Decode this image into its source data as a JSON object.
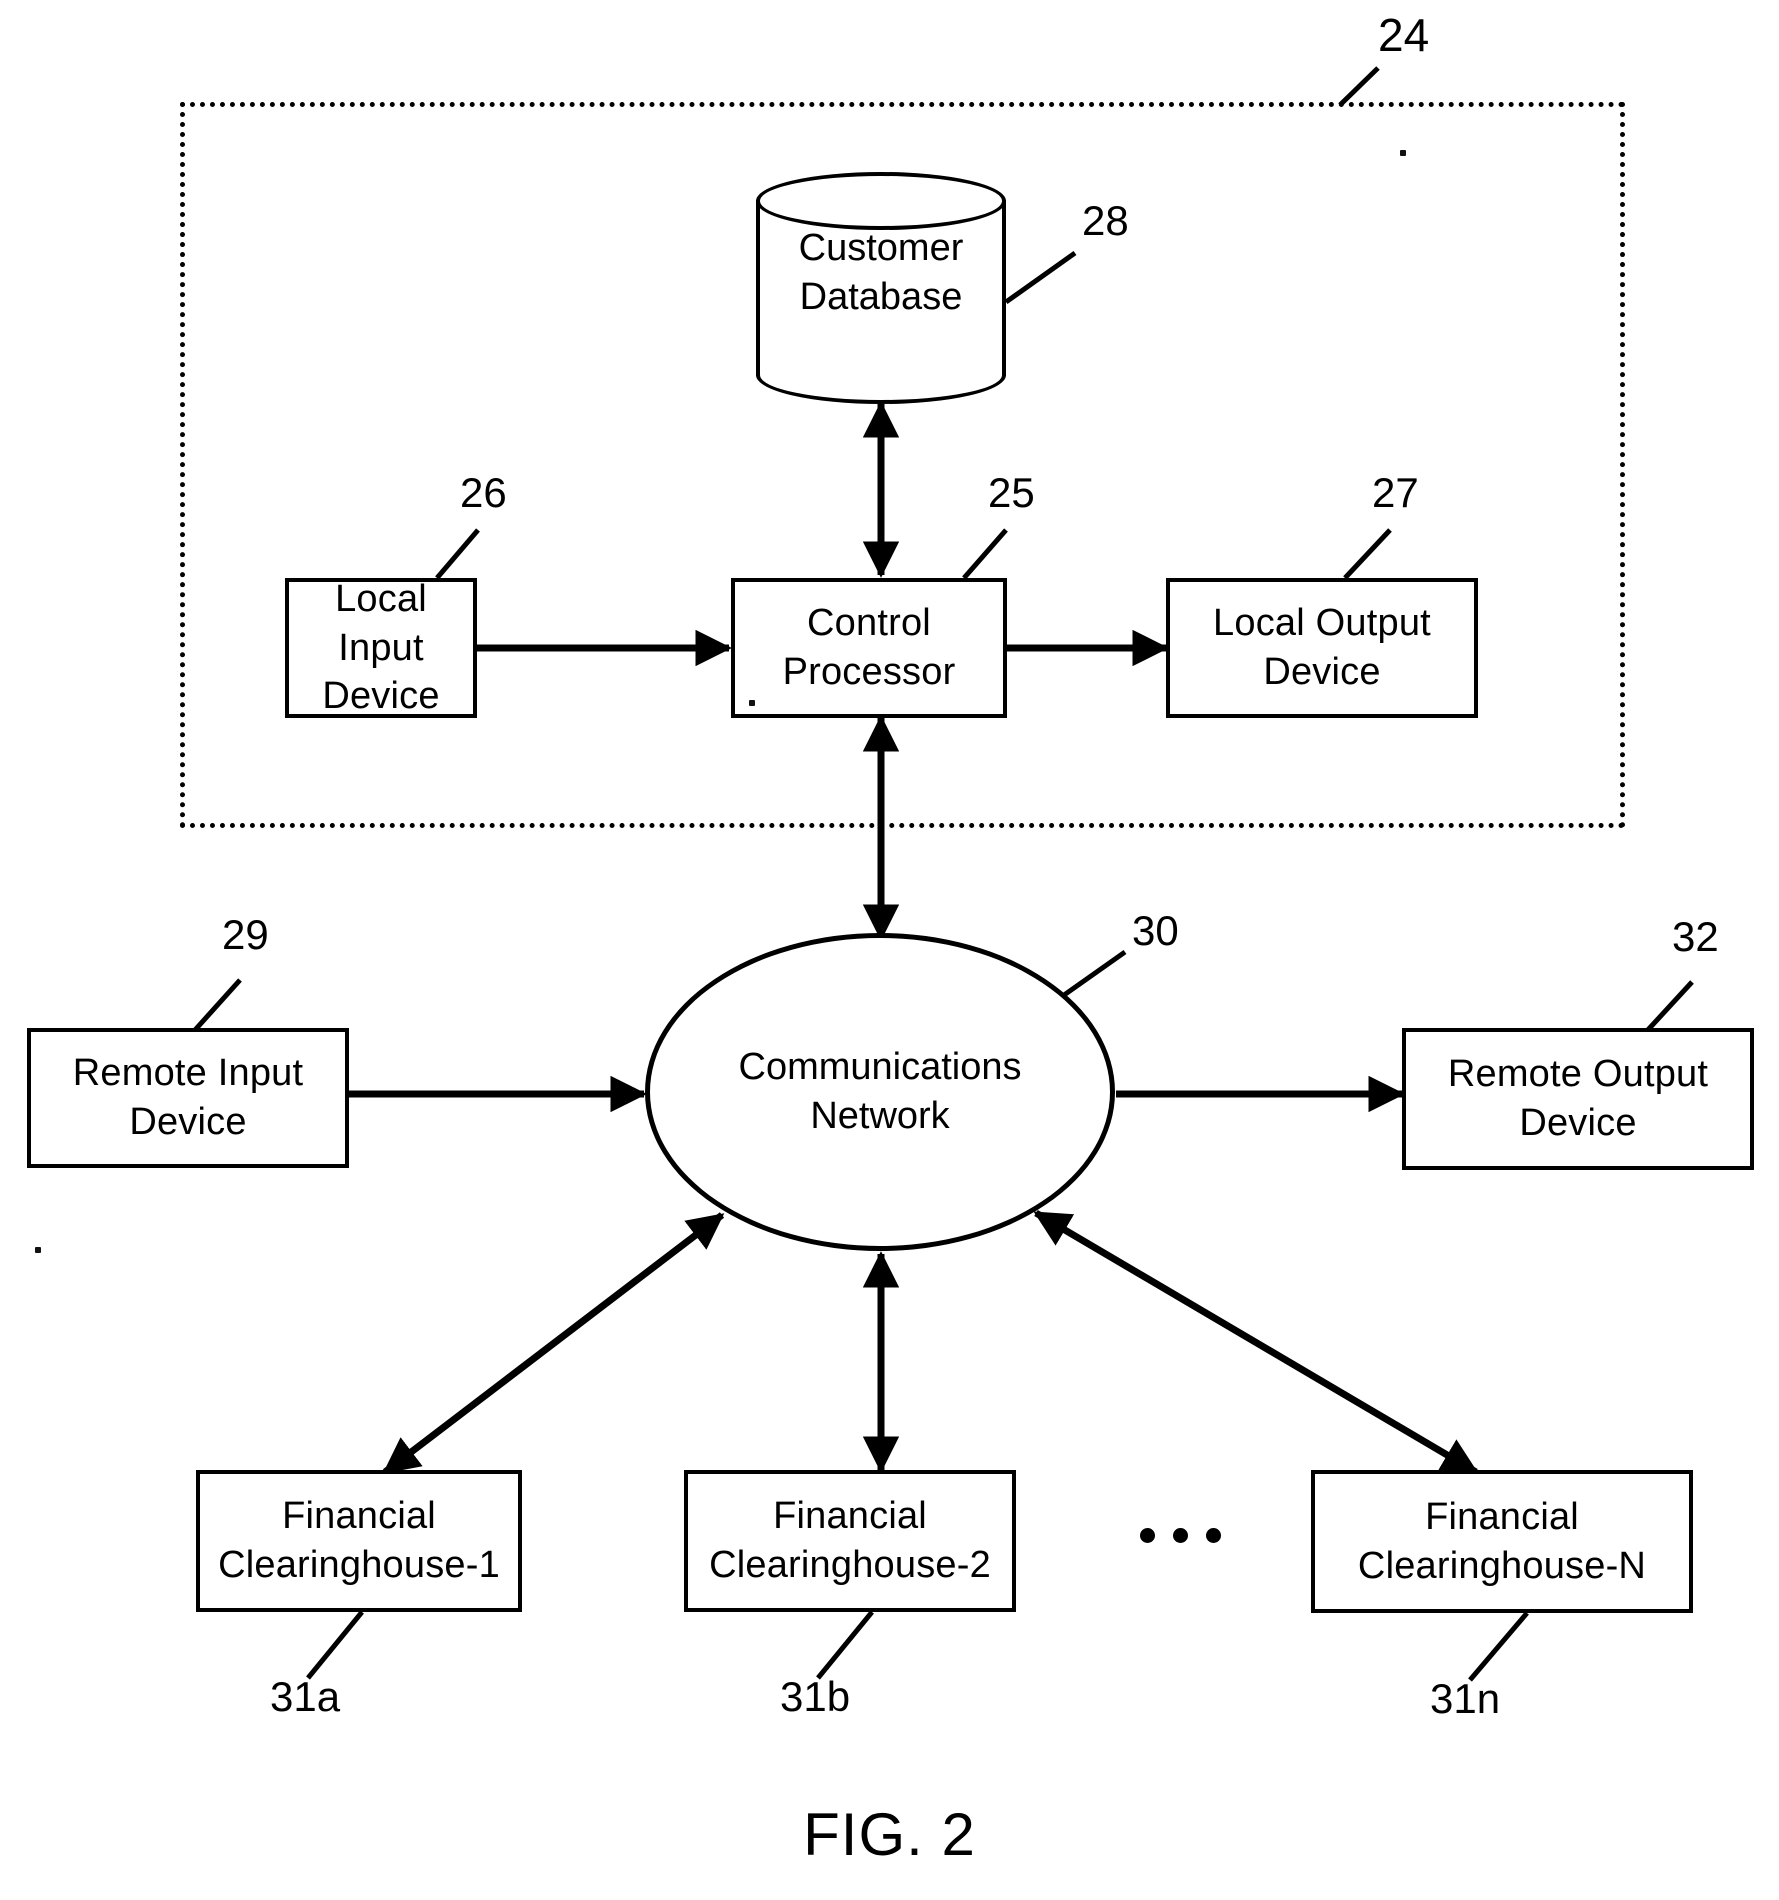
{
  "figure": {
    "caption": "FIG. 2",
    "enclosure": {
      "name": "system enclosure",
      "ref": "24"
    }
  },
  "nodes": [
    {
      "id": "customer-database",
      "label": "Customer\nDatabase",
      "ref": "28",
      "shape": "cylinder"
    },
    {
      "id": "local-input-device",
      "label": "Local Input\nDevice",
      "ref": "26",
      "shape": "rectangle"
    },
    {
      "id": "control-processor",
      "label": "Control\nProcessor",
      "ref": "25",
      "shape": "rectangle"
    },
    {
      "id": "local-output-device",
      "label": "Local Output\nDevice",
      "ref": "27",
      "shape": "rectangle"
    },
    {
      "id": "communications-network",
      "label": "Communications\nNetwork",
      "ref": "30",
      "shape": "ellipse"
    },
    {
      "id": "remote-input-device",
      "label": "Remote Input\nDevice",
      "ref": "29",
      "shape": "rectangle"
    },
    {
      "id": "remote-output-device",
      "label": "Remote Output\nDevice",
      "ref": "32",
      "shape": "rectangle"
    },
    {
      "id": "financial-clearinghouse-1",
      "label": "Financial\nClearinghouse-1",
      "ref": "31a",
      "shape": "rectangle"
    },
    {
      "id": "financial-clearinghouse-2",
      "label": "Financial\nClearinghouse-2",
      "ref": "31b",
      "shape": "rectangle"
    },
    {
      "id": "financial-clearinghouse-n",
      "label": "Financial\nClearinghouse-N",
      "ref": "31n",
      "shape": "rectangle"
    }
  ],
  "ellipsis": {
    "label": "...",
    "meaning": "additional financial clearinghouses"
  },
  "connections": [
    {
      "from": "control-processor",
      "to": "customer-database",
      "style": "double-arrow"
    },
    {
      "from": "local-input-device",
      "to": "control-processor",
      "style": "single-arrow"
    },
    {
      "from": "control-processor",
      "to": "local-output-device",
      "style": "single-arrow"
    },
    {
      "from": "control-processor",
      "to": "communications-network",
      "style": "double-arrow"
    },
    {
      "from": "remote-input-device",
      "to": "communications-network",
      "style": "single-arrow"
    },
    {
      "from": "communications-network",
      "to": "remote-output-device",
      "style": "single-arrow"
    },
    {
      "from": "communications-network",
      "to": "financial-clearinghouse-1",
      "style": "double-arrow"
    },
    {
      "from": "communications-network",
      "to": "financial-clearinghouse-2",
      "style": "double-arrow"
    },
    {
      "from": "communications-network",
      "to": "financial-clearinghouse-n",
      "style": "double-arrow"
    }
  ],
  "style": {
    "stroke": "#000000",
    "background": "#ffffff"
  }
}
